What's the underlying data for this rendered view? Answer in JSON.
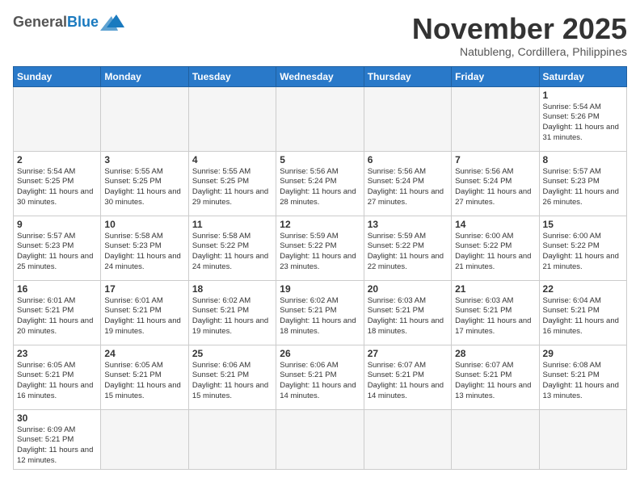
{
  "logo": {
    "general": "General",
    "blue": "Blue"
  },
  "title": {
    "month_year": "November 2025",
    "location": "Natubleng, Cordillera, Philippines"
  },
  "weekdays": [
    "Sunday",
    "Monday",
    "Tuesday",
    "Wednesday",
    "Thursday",
    "Friday",
    "Saturday"
  ],
  "weeks": [
    [
      {
        "day": "",
        "info": ""
      },
      {
        "day": "",
        "info": ""
      },
      {
        "day": "",
        "info": ""
      },
      {
        "day": "",
        "info": ""
      },
      {
        "day": "",
        "info": ""
      },
      {
        "day": "",
        "info": ""
      },
      {
        "day": "1",
        "info": "Sunrise: 5:54 AM\nSunset: 5:26 PM\nDaylight: 11 hours and 31 minutes."
      }
    ],
    [
      {
        "day": "2",
        "info": "Sunrise: 5:54 AM\nSunset: 5:25 PM\nDaylight: 11 hours and 30 minutes."
      },
      {
        "day": "3",
        "info": "Sunrise: 5:55 AM\nSunset: 5:25 PM\nDaylight: 11 hours and 30 minutes."
      },
      {
        "day": "4",
        "info": "Sunrise: 5:55 AM\nSunset: 5:25 PM\nDaylight: 11 hours and 29 minutes."
      },
      {
        "day": "5",
        "info": "Sunrise: 5:56 AM\nSunset: 5:24 PM\nDaylight: 11 hours and 28 minutes."
      },
      {
        "day": "6",
        "info": "Sunrise: 5:56 AM\nSunset: 5:24 PM\nDaylight: 11 hours and 27 minutes."
      },
      {
        "day": "7",
        "info": "Sunrise: 5:56 AM\nSunset: 5:24 PM\nDaylight: 11 hours and 27 minutes."
      },
      {
        "day": "8",
        "info": "Sunrise: 5:57 AM\nSunset: 5:23 PM\nDaylight: 11 hours and 26 minutes."
      }
    ],
    [
      {
        "day": "9",
        "info": "Sunrise: 5:57 AM\nSunset: 5:23 PM\nDaylight: 11 hours and 25 minutes."
      },
      {
        "day": "10",
        "info": "Sunrise: 5:58 AM\nSunset: 5:23 PM\nDaylight: 11 hours and 24 minutes."
      },
      {
        "day": "11",
        "info": "Sunrise: 5:58 AM\nSunset: 5:22 PM\nDaylight: 11 hours and 24 minutes."
      },
      {
        "day": "12",
        "info": "Sunrise: 5:59 AM\nSunset: 5:22 PM\nDaylight: 11 hours and 23 minutes."
      },
      {
        "day": "13",
        "info": "Sunrise: 5:59 AM\nSunset: 5:22 PM\nDaylight: 11 hours and 22 minutes."
      },
      {
        "day": "14",
        "info": "Sunrise: 6:00 AM\nSunset: 5:22 PM\nDaylight: 11 hours and 21 minutes."
      },
      {
        "day": "15",
        "info": "Sunrise: 6:00 AM\nSunset: 5:22 PM\nDaylight: 11 hours and 21 minutes."
      }
    ],
    [
      {
        "day": "16",
        "info": "Sunrise: 6:01 AM\nSunset: 5:21 PM\nDaylight: 11 hours and 20 minutes."
      },
      {
        "day": "17",
        "info": "Sunrise: 6:01 AM\nSunset: 5:21 PM\nDaylight: 11 hours and 19 minutes."
      },
      {
        "day": "18",
        "info": "Sunrise: 6:02 AM\nSunset: 5:21 PM\nDaylight: 11 hours and 19 minutes."
      },
      {
        "day": "19",
        "info": "Sunrise: 6:02 AM\nSunset: 5:21 PM\nDaylight: 11 hours and 18 minutes."
      },
      {
        "day": "20",
        "info": "Sunrise: 6:03 AM\nSunset: 5:21 PM\nDaylight: 11 hours and 18 minutes."
      },
      {
        "day": "21",
        "info": "Sunrise: 6:03 AM\nSunset: 5:21 PM\nDaylight: 11 hours and 17 minutes."
      },
      {
        "day": "22",
        "info": "Sunrise: 6:04 AM\nSunset: 5:21 PM\nDaylight: 11 hours and 16 minutes."
      }
    ],
    [
      {
        "day": "23",
        "info": "Sunrise: 6:05 AM\nSunset: 5:21 PM\nDaylight: 11 hours and 16 minutes."
      },
      {
        "day": "24",
        "info": "Sunrise: 6:05 AM\nSunset: 5:21 PM\nDaylight: 11 hours and 15 minutes."
      },
      {
        "day": "25",
        "info": "Sunrise: 6:06 AM\nSunset: 5:21 PM\nDaylight: 11 hours and 15 minutes."
      },
      {
        "day": "26",
        "info": "Sunrise: 6:06 AM\nSunset: 5:21 PM\nDaylight: 11 hours and 14 minutes."
      },
      {
        "day": "27",
        "info": "Sunrise: 6:07 AM\nSunset: 5:21 PM\nDaylight: 11 hours and 14 minutes."
      },
      {
        "day": "28",
        "info": "Sunrise: 6:07 AM\nSunset: 5:21 PM\nDaylight: 11 hours and 13 minutes."
      },
      {
        "day": "29",
        "info": "Sunrise: 6:08 AM\nSunset: 5:21 PM\nDaylight: 11 hours and 13 minutes."
      }
    ],
    [
      {
        "day": "30",
        "info": "Sunrise: 6:09 AM\nSunset: 5:21 PM\nDaylight: 11 hours and 12 minutes."
      },
      {
        "day": "",
        "info": ""
      },
      {
        "day": "",
        "info": ""
      },
      {
        "day": "",
        "info": ""
      },
      {
        "day": "",
        "info": ""
      },
      {
        "day": "",
        "info": ""
      },
      {
        "day": "",
        "info": ""
      }
    ]
  ]
}
